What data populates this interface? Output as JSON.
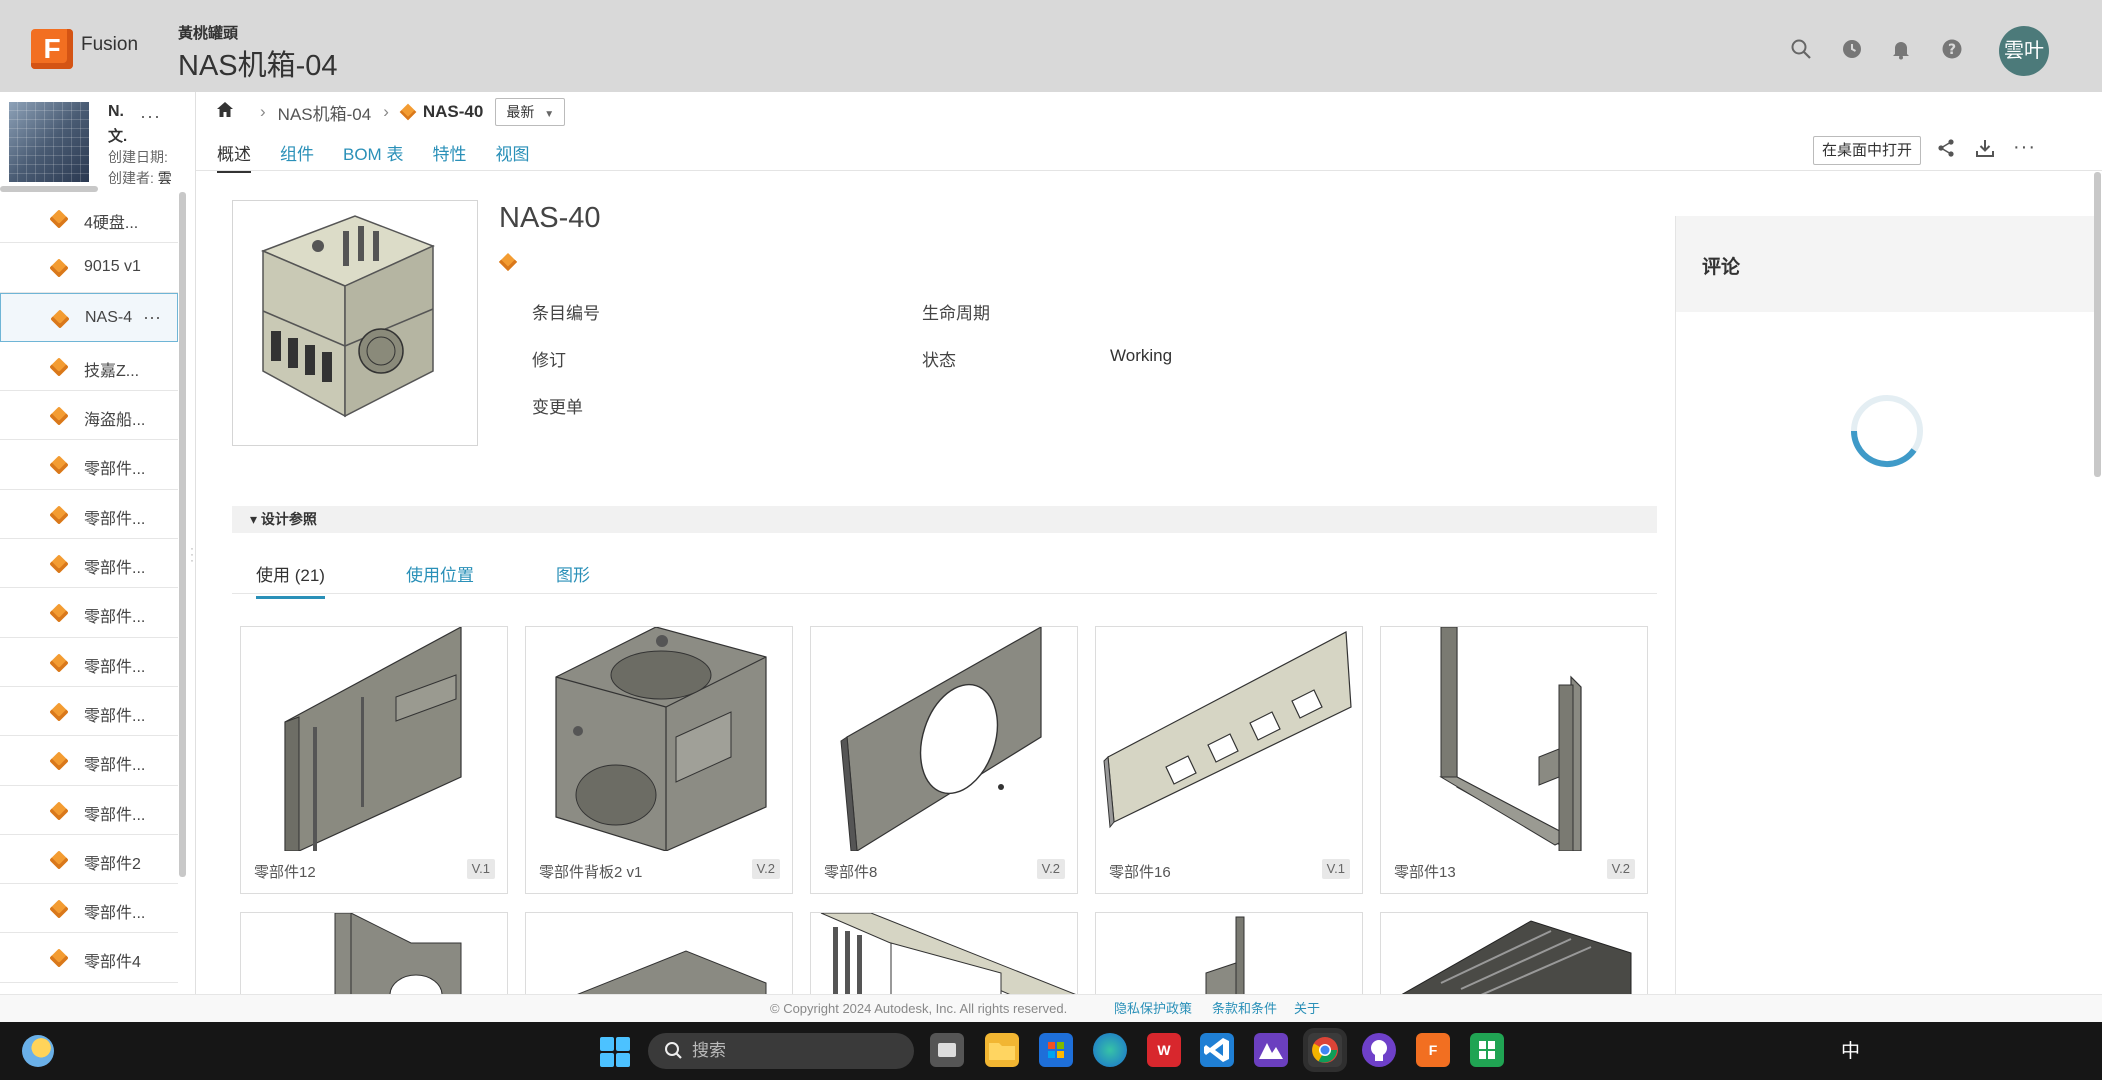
{
  "header": {
    "app_name": "Fusion",
    "logo_letter": "F",
    "project_subtitle": "黃桃罐頭",
    "project_title": "NAS机箱-04",
    "avatar_text": "雲叶",
    "icons": [
      "search-icon",
      "clock-icon",
      "bell-icon",
      "help-icon"
    ]
  },
  "sidebar": {
    "project_name": "N.",
    "project_line2": "文.",
    "created_date_label": "创建日期:",
    "creator_label": "创建者:",
    "creator_value": "雲",
    "more": "···",
    "items": [
      {
        "label": "4硬盘..."
      },
      {
        "label": "9015 v1"
      },
      {
        "label": "NAS-4",
        "active": true,
        "more": "···"
      },
      {
        "label": "技嘉Z..."
      },
      {
        "label": "海盗船..."
      },
      {
        "label": "零部件..."
      },
      {
        "label": "零部件..."
      },
      {
        "label": "零部件..."
      },
      {
        "label": "零部件..."
      },
      {
        "label": "零部件..."
      },
      {
        "label": "零部件..."
      },
      {
        "label": "零部件..."
      },
      {
        "label": "零部件..."
      },
      {
        "label": "零部件2"
      },
      {
        "label": "零部件..."
      },
      {
        "label": "零部件4"
      }
    ]
  },
  "breadcrumb": {
    "project": "NAS机箱-04",
    "current": "NAS-40",
    "version_select": "最新"
  },
  "tabs": [
    {
      "label": "概述",
      "active": true
    },
    {
      "label": "组件"
    },
    {
      "label": "BOM 表"
    },
    {
      "label": "特性"
    },
    {
      "label": "视图"
    }
  ],
  "toolbar": {
    "open_desktop": "在桌面中打开",
    "icons": [
      "share-icon",
      "download-icon",
      "more-icon"
    ]
  },
  "item": {
    "title": "NAS-40",
    "props": {
      "item_number_label": "条目编号",
      "revision_label": "修订",
      "change_order_label": "变更单",
      "lifecycle_label": "生命周期",
      "status_label": "状态",
      "status_value": "Working"
    }
  },
  "design_refs": {
    "section_label": "▾ 设计参照",
    "subtabs": [
      {
        "label": "使用 (21)",
        "active": true
      },
      {
        "label": "使用位置"
      },
      {
        "label": "图形"
      }
    ],
    "cards": [
      {
        "name": "零部件12",
        "version": "V.1"
      },
      {
        "name": "零部件背板2 v1",
        "version": "V.2"
      },
      {
        "name": "零部件8",
        "version": "V.2"
      },
      {
        "name": "零部件16",
        "version": "V.1"
      },
      {
        "name": "零部件13",
        "version": "V.2"
      }
    ]
  },
  "comments": {
    "title": "评论"
  },
  "footer": {
    "copyright": "© Copyright 2024 Autodesk, Inc. All rights reserved.",
    "privacy": "隐私保护政策",
    "terms": "条款和条件",
    "about": "关于"
  },
  "taskbar": {
    "search_placeholder": "搜索",
    "ime": "中",
    "fusion_label": "F",
    "wps_label": "W"
  }
}
